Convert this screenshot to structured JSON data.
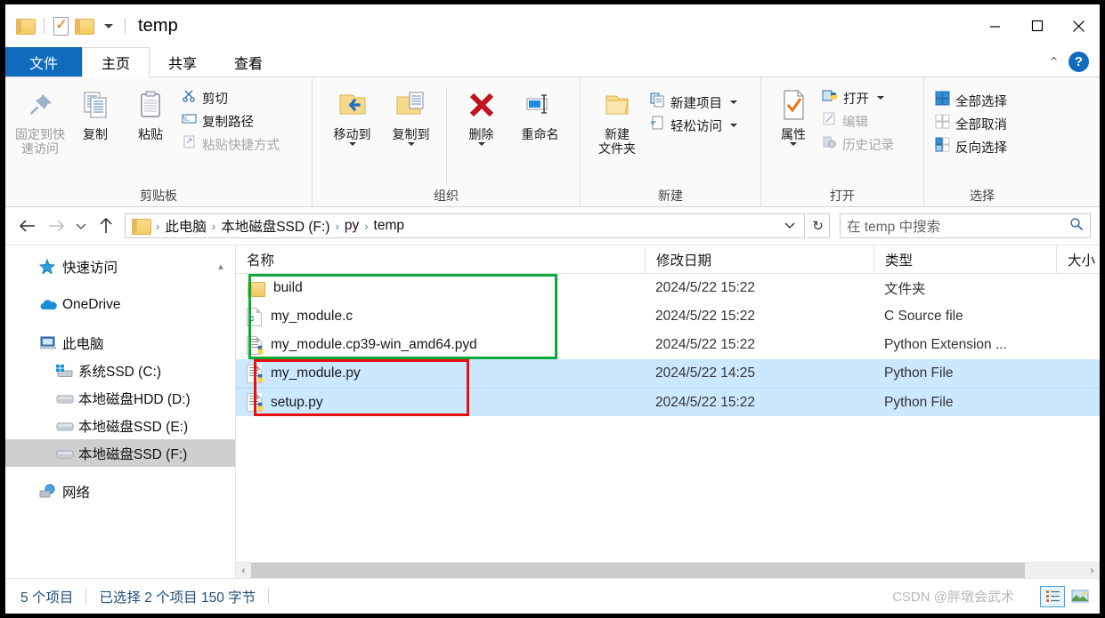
{
  "window": {
    "title": "temp",
    "minimize_label": "—",
    "maximize_label": "□",
    "close_label": "✕"
  },
  "quick_access": {
    "folder_icon": "folder-icon",
    "properties_icon": "properties-icon",
    "new_folder_icon": "folder-icon",
    "customize_label": "▾"
  },
  "tabs": [
    {
      "id": "file",
      "label": "文件"
    },
    {
      "id": "home",
      "label": "主页"
    },
    {
      "id": "share",
      "label": "共享"
    },
    {
      "id": "view",
      "label": "查看"
    }
  ],
  "tabs_right": {
    "collapse_icon": "chevron-up-icon",
    "help_label": "?"
  },
  "ribbon": {
    "groups": [
      {
        "id": "clipboard",
        "title": "剪贴板",
        "big": [
          {
            "id": "pin-to-quick-access",
            "label": "固定到快\n速访问",
            "line1": "固定到快",
            "line2": "速访问",
            "icon": "pin-icon",
            "dim": true
          },
          {
            "id": "copy",
            "label": "复制",
            "icon": "copy-icon"
          },
          {
            "id": "paste",
            "label": "粘贴",
            "icon": "paste-icon"
          }
        ],
        "small": [
          {
            "id": "cut",
            "label": "剪切",
            "icon": "scissors-icon"
          },
          {
            "id": "copy-path",
            "label": "复制路径",
            "icon": "copy-path-icon"
          },
          {
            "id": "paste-shortcut",
            "label": "粘贴快捷方式",
            "icon": "paste-shortcut-icon",
            "dim": true
          }
        ]
      },
      {
        "id": "organize",
        "title": "组织",
        "big": [
          {
            "id": "move-to",
            "label": "移动到",
            "icon": "move-to-icon",
            "has_caret": true
          },
          {
            "id": "copy-to",
            "label": "复制到",
            "icon": "copy-to-icon",
            "has_caret": true
          },
          {
            "id": "delete",
            "label": "删除",
            "icon": "delete-icon",
            "has_caret": true
          },
          {
            "id": "rename",
            "label": "重命名",
            "icon": "rename-icon"
          }
        ]
      },
      {
        "id": "new",
        "title": "新建",
        "big": [
          {
            "id": "new-folder",
            "line1": "新建",
            "line2": "文件夹",
            "label": "新建文件夹",
            "icon": "new-folder-icon"
          }
        ],
        "small": [
          {
            "id": "new-item",
            "label": "新建项目",
            "icon": "new-item-icon",
            "has_caret": true
          },
          {
            "id": "easy-access",
            "label": "轻松访问",
            "icon": "easy-access-icon",
            "has_caret": true
          }
        ]
      },
      {
        "id": "open",
        "title": "打开",
        "big": [
          {
            "id": "properties",
            "label": "属性",
            "icon": "properties-icon",
            "has_caret": true
          }
        ],
        "small": [
          {
            "id": "open",
            "label": "打开",
            "icon": "python-open-icon",
            "has_caret": true
          },
          {
            "id": "edit",
            "label": "编辑",
            "icon": "edit-icon",
            "dim": true
          },
          {
            "id": "history",
            "label": "历史记录",
            "icon": "history-icon",
            "dim": true
          }
        ]
      },
      {
        "id": "select",
        "title": "选择",
        "small": [
          {
            "id": "select-all",
            "label": "全部选择",
            "icon": "select-all-icon"
          },
          {
            "id": "select-none",
            "label": "全部取消",
            "icon": "select-none-icon"
          },
          {
            "id": "invert-selection",
            "label": "反向选择",
            "icon": "invert-selection-icon"
          }
        ]
      }
    ]
  },
  "addressbar": {
    "back_icon": "arrow-left-icon",
    "forward_icon": "arrow-right-icon",
    "recent_icon": "chevron-down-icon",
    "up_icon": "arrow-up-icon",
    "folder_icon": "folder-icon",
    "crumbs": [
      "此电脑",
      "本地磁盘SSD (F:)",
      "py",
      "temp"
    ],
    "separator": "›",
    "dropdown_icon": "chevron-down-icon",
    "refresh_icon": "refresh-icon",
    "search_placeholder": "在 temp 中搜索",
    "search_value": "",
    "search_icon": "search-icon"
  },
  "sidebar": {
    "items": [
      {
        "id": "quick-access",
        "label": "快速访问",
        "icon": "star-icon",
        "level": 0,
        "selected": false
      },
      {
        "id": "onedrive",
        "label": "OneDrive",
        "icon": "cloud-icon",
        "level": 0,
        "selected": false
      },
      {
        "id": "this-pc",
        "label": "此电脑",
        "icon": "computer-icon",
        "level": 0,
        "selected": false
      },
      {
        "id": "drive-c",
        "label": "系统SSD (C:)",
        "icon": "windows-drive-icon",
        "level": 1,
        "selected": false
      },
      {
        "id": "drive-d",
        "label": "本地磁盘HDD (D:)",
        "icon": "drive-icon",
        "level": 1,
        "selected": false
      },
      {
        "id": "drive-e",
        "label": "本地磁盘SSD (E:)",
        "icon": "drive-icon",
        "level": 1,
        "selected": false
      },
      {
        "id": "drive-f",
        "label": "本地磁盘SSD (F:)",
        "icon": "drive-icon",
        "level": 1,
        "selected": true
      },
      {
        "id": "network",
        "label": "网络",
        "icon": "network-icon",
        "level": 0,
        "selected": false
      }
    ]
  },
  "filelist": {
    "columns": [
      {
        "id": "name",
        "label": "名称"
      },
      {
        "id": "date",
        "label": "修改日期"
      },
      {
        "id": "type",
        "label": "类型"
      },
      {
        "id": "size",
        "label": "大小"
      }
    ],
    "sort_indicator": "▲",
    "rows": [
      {
        "name": "build",
        "date": "2024/5/22 15:22",
        "type": "文件夹",
        "size": "",
        "icon": "folder-icon",
        "selected": false
      },
      {
        "name": "my_module.c",
        "date": "2024/5/22 15:22",
        "type": "C Source file",
        "size": "",
        "icon": "c-file-icon",
        "selected": false
      },
      {
        "name": "my_module.cp39-win_amd64.pyd",
        "date": "2024/5/22 15:22",
        "type": "Python Extension ...",
        "size": "",
        "icon": "python-file-icon",
        "selected": false
      },
      {
        "name": "my_module.py",
        "date": "2024/5/22 14:25",
        "type": "Python File",
        "size": "",
        "icon": "python-file-icon",
        "selected": true
      },
      {
        "name": "setup.py",
        "date": "2024/5/22 15:22",
        "type": "Python File",
        "size": "",
        "icon": "python-file-icon",
        "selected": true
      }
    ]
  },
  "annotations": [
    {
      "id": "green-box",
      "color": "#0ea838",
      "covers": "build, my_module.c, my_module.cp39-win_amd64.pyd"
    },
    {
      "id": "red-box",
      "color": "#e81010",
      "covers": "my_module.py, setup.py"
    }
  ],
  "scrollbar": {
    "left_arrow": "‹",
    "right_arrow": "›"
  },
  "status": {
    "item_count": "5 个项目",
    "selection": "已选择 2 个项目  150 字节",
    "watermark": "CSDN @胖墩会武术",
    "view_details_icon": "details-view-icon",
    "view_thumbnails_icon": "thumbnails-view-icon"
  }
}
